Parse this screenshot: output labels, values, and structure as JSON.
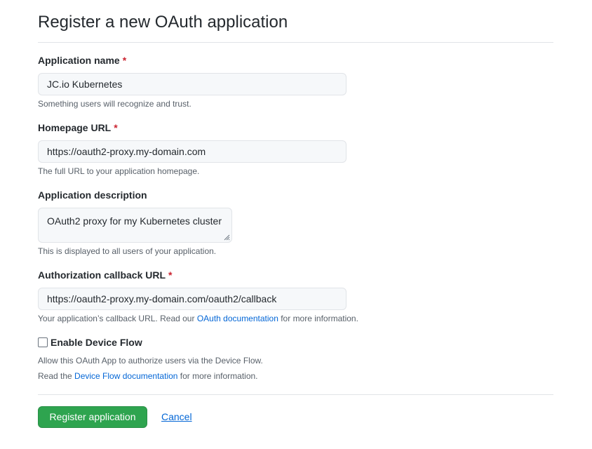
{
  "page": {
    "title": "Register a new OAuth application"
  },
  "form": {
    "app_name": {
      "label": "Application name",
      "required_mark": "*",
      "value": "JC.io Kubernetes",
      "help": "Something users will recognize and trust."
    },
    "homepage_url": {
      "label": "Homepage URL",
      "required_mark": "*",
      "value": "https://oauth2-proxy.my-domain.com",
      "help": "The full URL to your application homepage."
    },
    "description": {
      "label": "Application description",
      "value": "OAuth2 proxy for my Kubernetes cluster",
      "help": "This is displayed to all users of your application."
    },
    "callback_url": {
      "label": "Authorization callback URL",
      "required_mark": "*",
      "value": "https://oauth2-proxy.my-domain.com/oauth2/callback",
      "help_prefix": "Your application’s callback URL. Read our ",
      "help_link": "OAuth documentation",
      "help_suffix": " for more information."
    },
    "device_flow": {
      "label": "Enable Device Flow",
      "checked": false,
      "help_line1": "Allow this OAuth App to authorize users via the Device Flow.",
      "help_line2_prefix": "Read the ",
      "help_line2_link": "Device Flow documentation",
      "help_line2_suffix": " for more information."
    }
  },
  "actions": {
    "submit_label": "Register application",
    "cancel_label": "Cancel"
  },
  "colors": {
    "primary_button": "#2ea44f",
    "link": "#0366d6",
    "required": "#cb2431"
  }
}
